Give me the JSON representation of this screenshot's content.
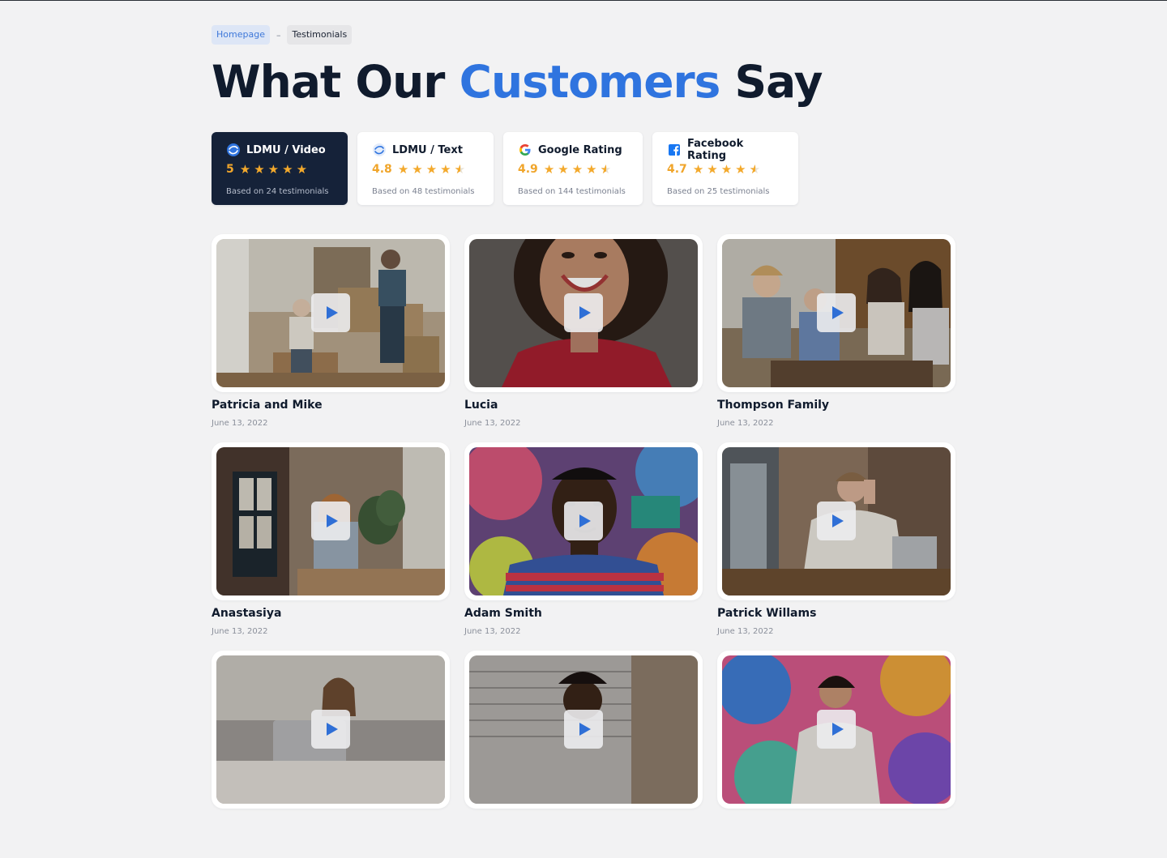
{
  "breadcrumb": {
    "home": "Homepage",
    "separator": "–",
    "current": "Testimonials"
  },
  "headline": {
    "before": "What Our",
    "accent": "Customers",
    "after": "Say",
    "accent_color": "#2f74df"
  },
  "ratings": [
    {
      "title": "LDMU / Video",
      "icon": "ldmu-logo-icon",
      "score": "5",
      "stars": 5,
      "based": "Based on 24 testimonials",
      "active": true
    },
    {
      "title": "LDMU / Text",
      "icon": "ldmu-logo-icon",
      "score": "4.8",
      "stars": 4.8,
      "based": "Based on 48 testimonials",
      "active": false
    },
    {
      "title": "Google Rating",
      "icon": "google-logo-icon",
      "score": "4.9",
      "stars": 4.9,
      "based": "Based on 144 testimonials",
      "active": false
    },
    {
      "title": "Facebook Rating",
      "icon": "facebook-logo-icon",
      "score": "4.7",
      "stars": 4.7,
      "based": "Based on 25 testimonials",
      "active": false
    }
  ],
  "testimonials": [
    {
      "name": "Patricia and Mike",
      "date": "June 13, 2022",
      "scene": "moving-boxes"
    },
    {
      "name": "Lucia",
      "date": "June 13, 2022",
      "scene": "smiling-woman"
    },
    {
      "name": "Thompson Family",
      "date": "June 13, 2022",
      "scene": "family-meeting"
    },
    {
      "name": "Anastasiya",
      "date": "June 13, 2022",
      "scene": "apartment-window"
    },
    {
      "name": "Adam Smith",
      "date": "June 13, 2022",
      "scene": "graffiti-man"
    },
    {
      "name": "Patrick Willams",
      "date": "June 13, 2022",
      "scene": "phone-call"
    },
    {
      "name": "",
      "date": "",
      "scene": "laptop-bed"
    },
    {
      "name": "",
      "date": "",
      "scene": "garage-door"
    },
    {
      "name": "",
      "date": "",
      "scene": "mural-woman"
    }
  ],
  "icons": {
    "play": "play-icon",
    "star": "star-icon"
  },
  "colors": {
    "dark_card": "#152239",
    "star": "#f3a92c",
    "score": "#f0a52b",
    "link": "#3e78d9"
  }
}
